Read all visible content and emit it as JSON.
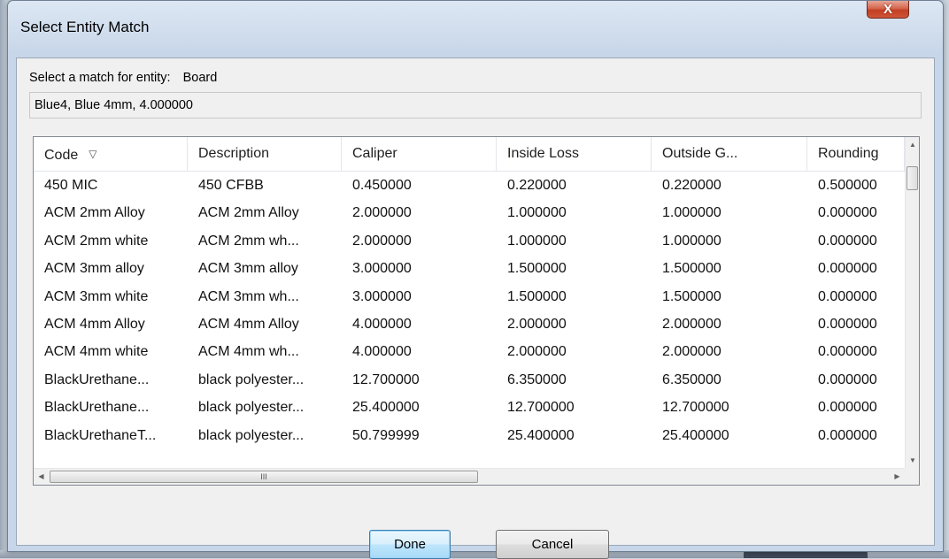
{
  "window": {
    "title": "Select Entity Match",
    "close_glyph": "X"
  },
  "entity": {
    "prompt": "Select a match for entity:",
    "name": "Board",
    "selected_match": "Blue4, Blue 4mm, 4.000000"
  },
  "table": {
    "columns": [
      "Code",
      "Description",
      "Caliper",
      "Inside Loss",
      "Outside G...",
      "Rounding"
    ],
    "sort_icon": "sort-icon",
    "rows": [
      [
        "450 MIC",
        "450 CFBB",
        "0.450000",
        "0.220000",
        "0.220000",
        "0.500000"
      ],
      [
        "ACM 2mm Alloy",
        "ACM 2mm Alloy",
        "2.000000",
        "1.000000",
        "1.000000",
        "0.000000"
      ],
      [
        "ACM 2mm white",
        "ACM 2mm wh...",
        "2.000000",
        "1.000000",
        "1.000000",
        "0.000000"
      ],
      [
        "ACM 3mm alloy",
        "ACM 3mm alloy",
        "3.000000",
        "1.500000",
        "1.500000",
        "0.000000"
      ],
      [
        "ACM 3mm white",
        "ACM 3mm wh...",
        "3.000000",
        "1.500000",
        "1.500000",
        "0.000000"
      ],
      [
        "ACM 4mm Alloy",
        "ACM 4mm Alloy",
        "4.000000",
        "2.000000",
        "2.000000",
        "0.000000"
      ],
      [
        "ACM 4mm white",
        "ACM 4mm wh...",
        "4.000000",
        "2.000000",
        "2.000000",
        "0.000000"
      ],
      [
        "BlackUrethane...",
        "black polyester...",
        "12.700000",
        "6.350000",
        "6.350000",
        "0.000000"
      ],
      [
        "BlackUrethane...",
        "black polyester...",
        "25.400000",
        "12.700000",
        "12.700000",
        "0.000000"
      ],
      [
        "BlackUrethaneT...",
        "black polyester...",
        "50.799999",
        "25.400000",
        "25.400000",
        "0.000000"
      ]
    ],
    "hscroll_thumb_grip": "III"
  },
  "buttons": {
    "done": "Done",
    "cancel": "Cancel"
  }
}
